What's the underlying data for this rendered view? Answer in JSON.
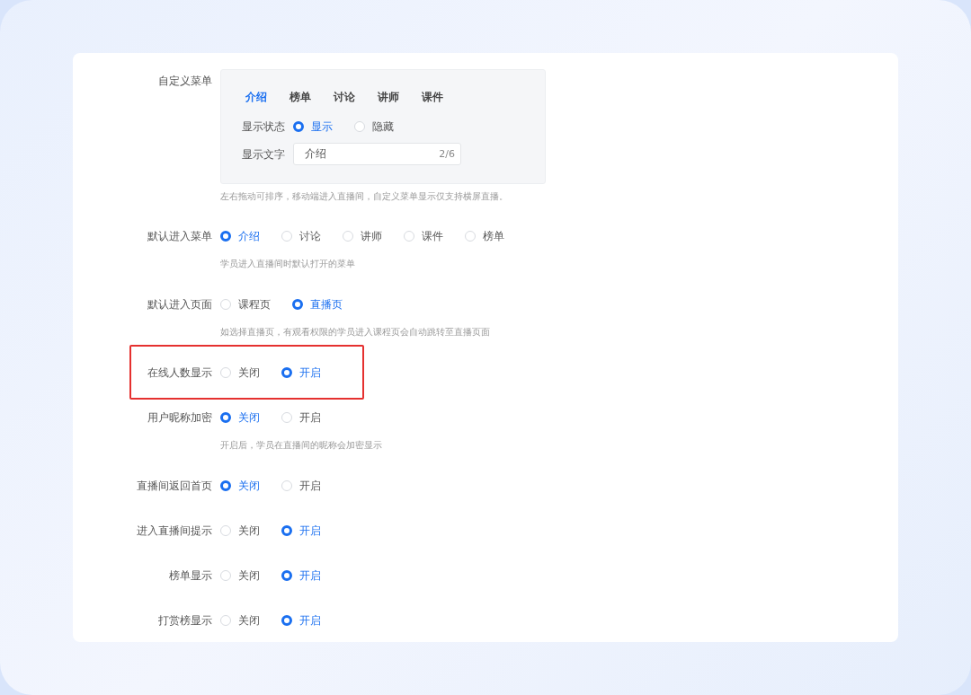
{
  "custom_menu": {
    "label": "自定义菜单",
    "tabs": [
      {
        "label": "介绍",
        "selected": true
      },
      {
        "label": "榜单",
        "selected": false
      },
      {
        "label": "讨论",
        "selected": false
      },
      {
        "label": "讲师",
        "selected": false
      },
      {
        "label": "课件",
        "selected": false
      }
    ],
    "status": {
      "label": "显示状态",
      "options": [
        {
          "label": "显示",
          "selected": true
        },
        {
          "label": "隐藏",
          "selected": false
        }
      ]
    },
    "text_field": {
      "label": "显示文字",
      "value": "介绍",
      "counter": "2/6"
    },
    "hint": "左右拖动可排序，移动端进入直播间，自定义菜单显示仅支持横屏直播。"
  },
  "settings": [
    {
      "label": "默认进入菜单",
      "highlighted": false,
      "options": [
        {
          "label": "介绍",
          "selected": true
        },
        {
          "label": "讨论",
          "selected": false
        },
        {
          "label": "讲师",
          "selected": false
        },
        {
          "label": "课件",
          "selected": false
        },
        {
          "label": "榜单",
          "selected": false
        }
      ],
      "hint": "学员进入直播间时默认打开的菜单"
    },
    {
      "label": "默认进入页面",
      "highlighted": false,
      "options": [
        {
          "label": "课程页",
          "selected": false
        },
        {
          "label": "直播页",
          "selected": true
        }
      ],
      "hint": "如选择直播页，有观看权限的学员进入课程页会自动跳转至直播页面"
    },
    {
      "label": "在线人数显示",
      "highlighted": true,
      "options": [
        {
          "label": "关闭",
          "selected": false
        },
        {
          "label": "开启",
          "selected": true
        }
      ]
    },
    {
      "label": "用户昵称加密",
      "highlighted": false,
      "options": [
        {
          "label": "关闭",
          "selected": true
        },
        {
          "label": "开启",
          "selected": false
        }
      ],
      "hint": "开启后，学员在直播间的昵称会加密显示"
    },
    {
      "label": "直播间返回首页",
      "highlighted": false,
      "options": [
        {
          "label": "关闭",
          "selected": true
        },
        {
          "label": "开启",
          "selected": false
        }
      ]
    },
    {
      "label": "进入直播间提示",
      "highlighted": false,
      "options": [
        {
          "label": "关闭",
          "selected": false
        },
        {
          "label": "开启",
          "selected": true
        }
      ]
    },
    {
      "label": "榜单显示",
      "highlighted": false,
      "options": [
        {
          "label": "关闭",
          "selected": false
        },
        {
          "label": "开启",
          "selected": true
        }
      ]
    },
    {
      "label": "打赏榜显示",
      "highlighted": false,
      "options": [
        {
          "label": "关闭",
          "selected": false
        },
        {
          "label": "开启",
          "selected": true
        }
      ]
    }
  ]
}
